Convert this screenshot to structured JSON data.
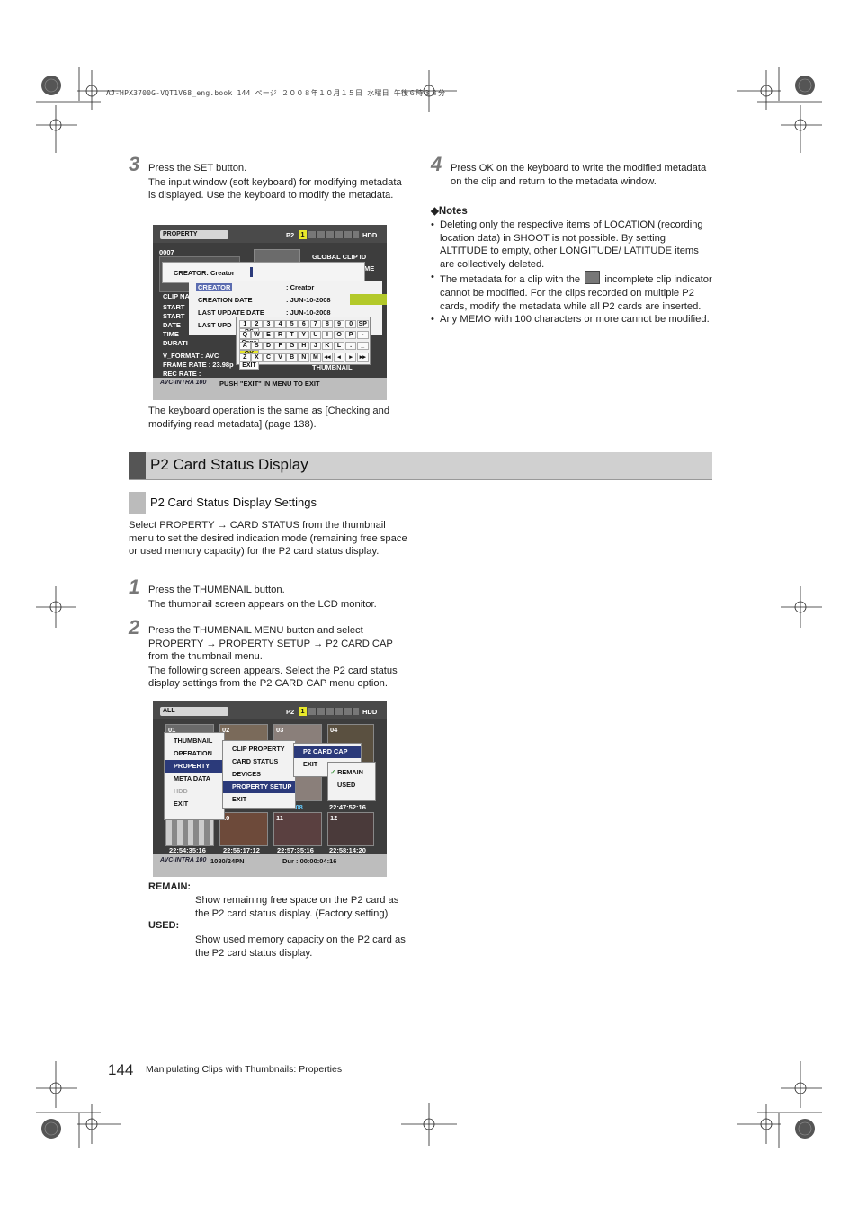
{
  "header": {
    "file_line": "AJ-HPX3700G-VQT1V68_eng.book  144 ページ  ２００８年１０月１５日  水曜日  午後６時３８分"
  },
  "step3": {
    "number": "3",
    "line1": "Press the SET button.",
    "desc": "The input window (soft keyboard) for modifying metadata is displayed. Use the keyboard to modify the metadata."
  },
  "screen1": {
    "top_label": "PROPERTY",
    "p2": "P2",
    "slot": "1",
    "hdd": "HDD",
    "clip_no": "0007",
    "global_clip_id": "GLOBAL CLIP ID",
    "me": "ME",
    "input_text": "CREATOR: Creator",
    "creator_label": "CREATOR",
    "creator_value": ":   Creator",
    "creation_date_label": "CREATION DATE",
    "creation_date_value": ":   JUN-10-2008",
    "last_update_label": "LAST UPDATE DATE",
    "last_update_value": ":   JUN-10-2008",
    "last_upd_partial": "LAST UPD",
    "left_labels": [
      "CLIP NA",
      "START",
      "START",
      "DATE",
      "TIME",
      "DURATI"
    ],
    "v_format": "V_FORMAT    : AVC",
    "frame_rate": "FRAME RATE   : 23.98p",
    "rec_rate": "REC RATE      :",
    "thumbnail": "THUMBNAIL",
    "logo": "AVC-INTRA 100",
    "bottom_msg": "PUSH \"EXIT\" IN MENU TO EXIT",
    "key_rows": [
      [
        "1",
        "2",
        "3",
        "4",
        "5",
        "6",
        "7",
        "8",
        "9",
        "0",
        "SP",
        "BS"
      ],
      [
        "Q",
        "W",
        "E",
        "R",
        "T",
        "Y",
        "U",
        "I",
        "O",
        "P",
        "-",
        "Caps"
      ],
      [
        "A",
        "S",
        "D",
        "F",
        "G",
        "H",
        "J",
        "K",
        "L",
        ".",
        "_",
        "OK"
      ],
      [
        "Z",
        "X",
        "C",
        "V",
        "B",
        "N",
        "M",
        "◂◂",
        "◂",
        "▸",
        "▸▸",
        "EXIT"
      ]
    ]
  },
  "step3_note": "The keyboard operation is the same as [Checking and modifying read metadata] (page 138).",
  "step4": {
    "number": "4",
    "text": "Press OK on the keyboard to write the modified metadata on the clip and return to the metadata window."
  },
  "notes": {
    "title": "◆Notes",
    "items": [
      "Deleting only the respective items of LOCATION (recording location data) in SHOOT is not possible. By setting ALTITUDE to empty, other LONGITUDE/ LATITUDE items are collectively deleted.",
      "The metadata for a clip with the",
      "incomplete clip indicator cannot be modified. For the clips recorded on multiple P2 cards, modify the metadata while all P2 cards are inserted.",
      "Any MEMO with 100 characters or more cannot be modified."
    ]
  },
  "section": {
    "title": "P2 Card Status Display"
  },
  "subsection": {
    "title": "P2 Card Status Display Settings"
  },
  "intro": "Select PROPERTY → CARD STATUS from the thumbnail menu to set the desired indication mode (remaining free space or used memory capacity) for the P2 card status display.",
  "step1": {
    "number": "1",
    "line1": "Press the THUMBNAIL button.",
    "line2": "The thumbnail screen appears on the LCD monitor."
  },
  "step2": {
    "number": "2",
    "line1": "Press the THUMBNAIL MENU button and select PROPERTY → PROPERTY SETUP → P2 CARD CAP from the thumbnail menu.",
    "line2": "The following screen appears. Select the P2 card status display settings from the P2 CARD CAP menu option."
  },
  "screen2": {
    "top_label": "ALL",
    "p2": "P2",
    "slot": "1",
    "hdd": "HDD",
    "thumb_nums": [
      "01",
      "02",
      "03",
      "04",
      "09",
      "10",
      "11",
      "12"
    ],
    "menu1": [
      "THUMBNAIL",
      "OPERATION",
      "PROPERTY",
      "META DATA",
      "HDD",
      "EXIT"
    ],
    "menu2": [
      "CLIP PROPERTY",
      "CARD STATUS",
      "DEVICES",
      "PROPERTY SETUP",
      "EXIT"
    ],
    "menu3": [
      "P2 CARD CAP",
      "EXIT"
    ],
    "menu4": [
      "REMAIN",
      "USED"
    ],
    "check": "✓",
    "tc_mid": ":08",
    "tc_mid2": "22:47:52:16",
    "timecodes": [
      "22:54:35:16",
      "22:56:17:12",
      "22:57:35:16",
      "22:58:14:20"
    ],
    "logo": "AVC-INTRA 100",
    "format": "1080/24PN",
    "dur": "Dur : 00:00:04:16"
  },
  "remain": {
    "label": "REMAIN:",
    "desc": "Show remaining free space on the P2 card as the P2 card status display. (Factory setting)"
  },
  "used": {
    "label": "USED:",
    "desc": "Show used memory capacity on the P2 card as the P2 card status display."
  },
  "footer": {
    "page": "144",
    "text": "Manipulating Clips with Thumbnails: Properties"
  }
}
